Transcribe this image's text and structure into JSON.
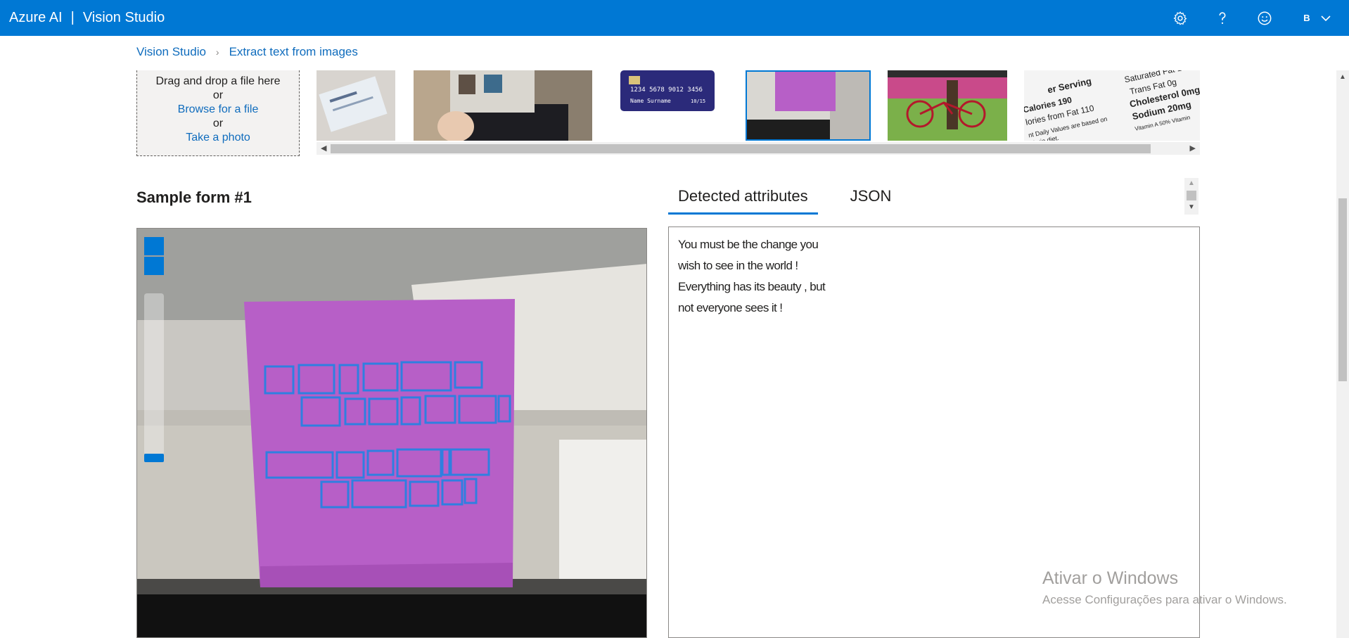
{
  "header": {
    "brand": "Azure AI",
    "separator": "|",
    "product": "Vision Studio",
    "user_initial": "B"
  },
  "breadcrumb": {
    "root": "Vision Studio",
    "current": "Extract text from images"
  },
  "dropzone": {
    "line1": "Drag and drop a file here",
    "or1": "or",
    "browse": "Browse for a file",
    "or2": "or",
    "photo": "Take a photo"
  },
  "card_text": {
    "number": "1234 5678 9012 3456",
    "name": "Name Surname",
    "expiry": "10/15"
  },
  "nutrition_text": {
    "l1": "er Serving",
    "l2": "Calories 190",
    "l3": "lories from Fat 110",
    "l4": "nt Daily Values are based on",
    "l5": "alorie diet.",
    "r1": "Saturated Fat 1",
    "r2": "Trans Fat 0g",
    "r3": "Cholesterol 0mg",
    "r4": "Sodium 20mg",
    "r5": "Vitamin A 50% Vitamin"
  },
  "section": {
    "title": "Sample form #1"
  },
  "tabs": [
    {
      "label": "Detected attributes",
      "active": true
    },
    {
      "label": "JSON",
      "active": false
    }
  ],
  "result_lines": [
    "You must be the change you",
    "wish to see in the world !",
    "Everything has its beauty , but",
    "not everyone sees it !"
  ],
  "watermark": {
    "title": "Ativar o Windows",
    "subtitle": "Acesse Configurações para ativar o Windows."
  },
  "colors": {
    "accent": "#0078d4",
    "note": "#b75fc7",
    "box": "#2f7fe0"
  }
}
